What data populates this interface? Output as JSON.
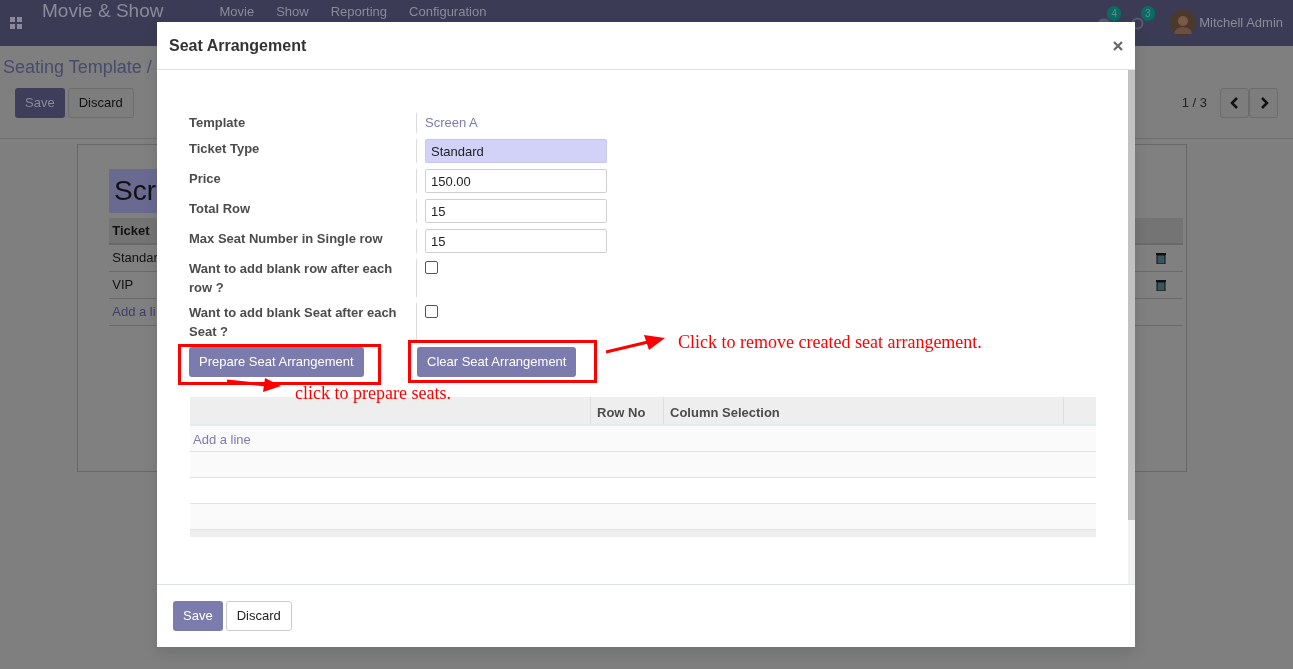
{
  "navbar": {
    "app_title": "Movie & Show",
    "menus": [
      "Movie",
      "Show",
      "Reporting",
      "Configuration"
    ],
    "chat_count": "4",
    "activity_count": "3",
    "user": "Mitchell Admin"
  },
  "control_panel": {
    "breadcrumb": "Seating Template /",
    "buttons": [
      "Save",
      "Discard"
    ],
    "pager": "1 / 3"
  },
  "record": {
    "title": "Scr",
    "table_header": "Ticket",
    "rows": [
      "Standar",
      "VIP"
    ],
    "add_line": "Add a li"
  },
  "dialog": {
    "title": "Seat Arrangement",
    "fields": [
      {
        "kind": "link",
        "label": "Template",
        "value": "Screen A"
      },
      {
        "kind": "select",
        "label": "Ticket Type",
        "value": "Standard"
      },
      {
        "kind": "input",
        "label": "Price",
        "value": "150.00"
      },
      {
        "kind": "input",
        "label": "Total Row",
        "value": "15"
      },
      {
        "kind": "input",
        "label": "Max Seat Number in Single row",
        "value": "15"
      },
      {
        "kind": "checkbox",
        "label": "Want to add blank row after each row ?",
        "checked": false
      },
      {
        "kind": "checkbox",
        "label": "Want to add blank Seat after each Seat ?",
        "checked": false
      }
    ],
    "actions": [
      {
        "label": "Prepare Seat Arrangement",
        "note": "click to prepare seats."
      },
      {
        "label": "Clear Seat Arrangement",
        "note": "Click to remove created seat arrangement."
      }
    ],
    "lines_table": {
      "columns": [
        "Row No",
        "Column Selection"
      ],
      "add_line": "Add a line"
    },
    "footer_buttons": [
      "Save",
      "Discard"
    ]
  }
}
